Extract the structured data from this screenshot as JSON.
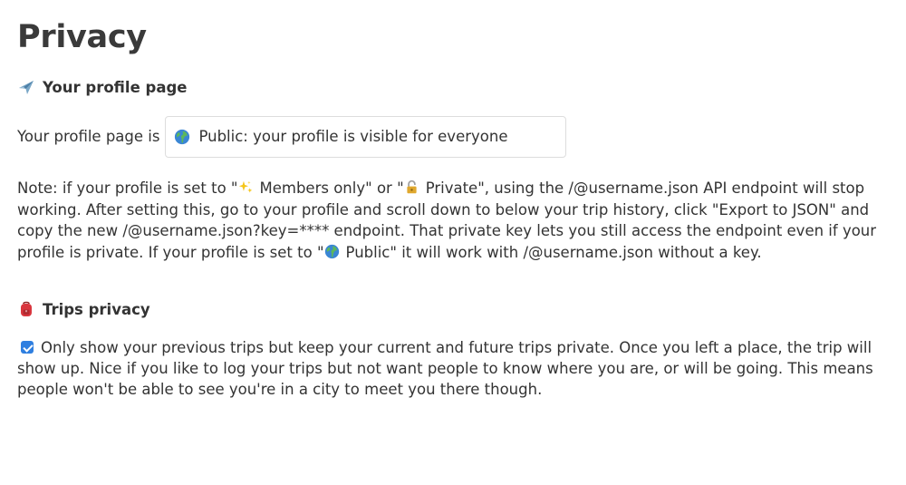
{
  "page": {
    "title": "Privacy"
  },
  "profile_section": {
    "icon": "airplane-icon",
    "heading": "Your profile page",
    "row_label": "Your profile page is",
    "visibility_select": {
      "icon": "globe-icon",
      "value": "Public: your profile is visible for everyone"
    },
    "note": {
      "part1": "Note: if your profile is set to \"",
      "members_icon": "sparkles-icon",
      "members_label": "Members only",
      "part2": "\" or \"",
      "private_icon": "lock-icon",
      "private_label": "Private",
      "part3": "\", using the /@username.json API endpoint will stop working. After setting this, go to your profile and scroll down to below your trip history, click \"Export to JSON\" and copy the new /@username.json?key=**** endpoint. That private key lets you still access the endpoint even if your profile is private. If your profile is set to \"",
      "public_icon": "globe-icon",
      "public_label": "Public",
      "part4": "\" it will work with /@username.json without a key."
    }
  },
  "trips_section": {
    "icon": "backpack-icon",
    "heading": "Trips privacy",
    "checkbox_checked": true,
    "checkbox_label": "Only show your previous trips but keep your current and future trips private. Once you left a place, the trip will show up. Nice if you like to log your trips but not want people to know where you are, or will be going. This means people won't be able to see you're in a city to meet you there though."
  },
  "colors": {
    "text": "#333333",
    "checkbox": "#2f7fe0",
    "border": "#dddddd"
  }
}
